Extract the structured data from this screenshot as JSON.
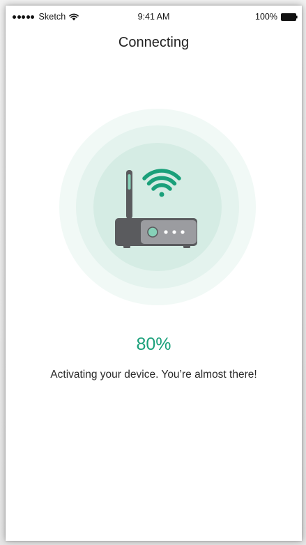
{
  "status_bar": {
    "carrier": "Sketch",
    "time": "9:41 AM",
    "battery_percent": "100%",
    "signal_icon": "signal-dots-icon",
    "wifi_icon": "wifi-icon",
    "battery_icon": "battery-icon"
  },
  "nav": {
    "title": "Connecting"
  },
  "illustration": {
    "icon": "router-icon",
    "wifi_signal_icon": "wifi-icon",
    "colors": {
      "halo_outer": "#f1f9f6",
      "halo_mid": "#e4f3ee",
      "halo_inner": "#d5ece4",
      "router_body": "#5a5b5e",
      "router_panel": "#9b9ca0",
      "accent": "#1aa07a",
      "led": "#86d1b8"
    }
  },
  "progress": {
    "label": "80%",
    "value": 0.8
  },
  "message": {
    "text": "Activating your device. You’re almost there!"
  },
  "colors": {
    "accent": "#1aa07a",
    "text": "#2a2a2a",
    "background": "#ffffff"
  }
}
